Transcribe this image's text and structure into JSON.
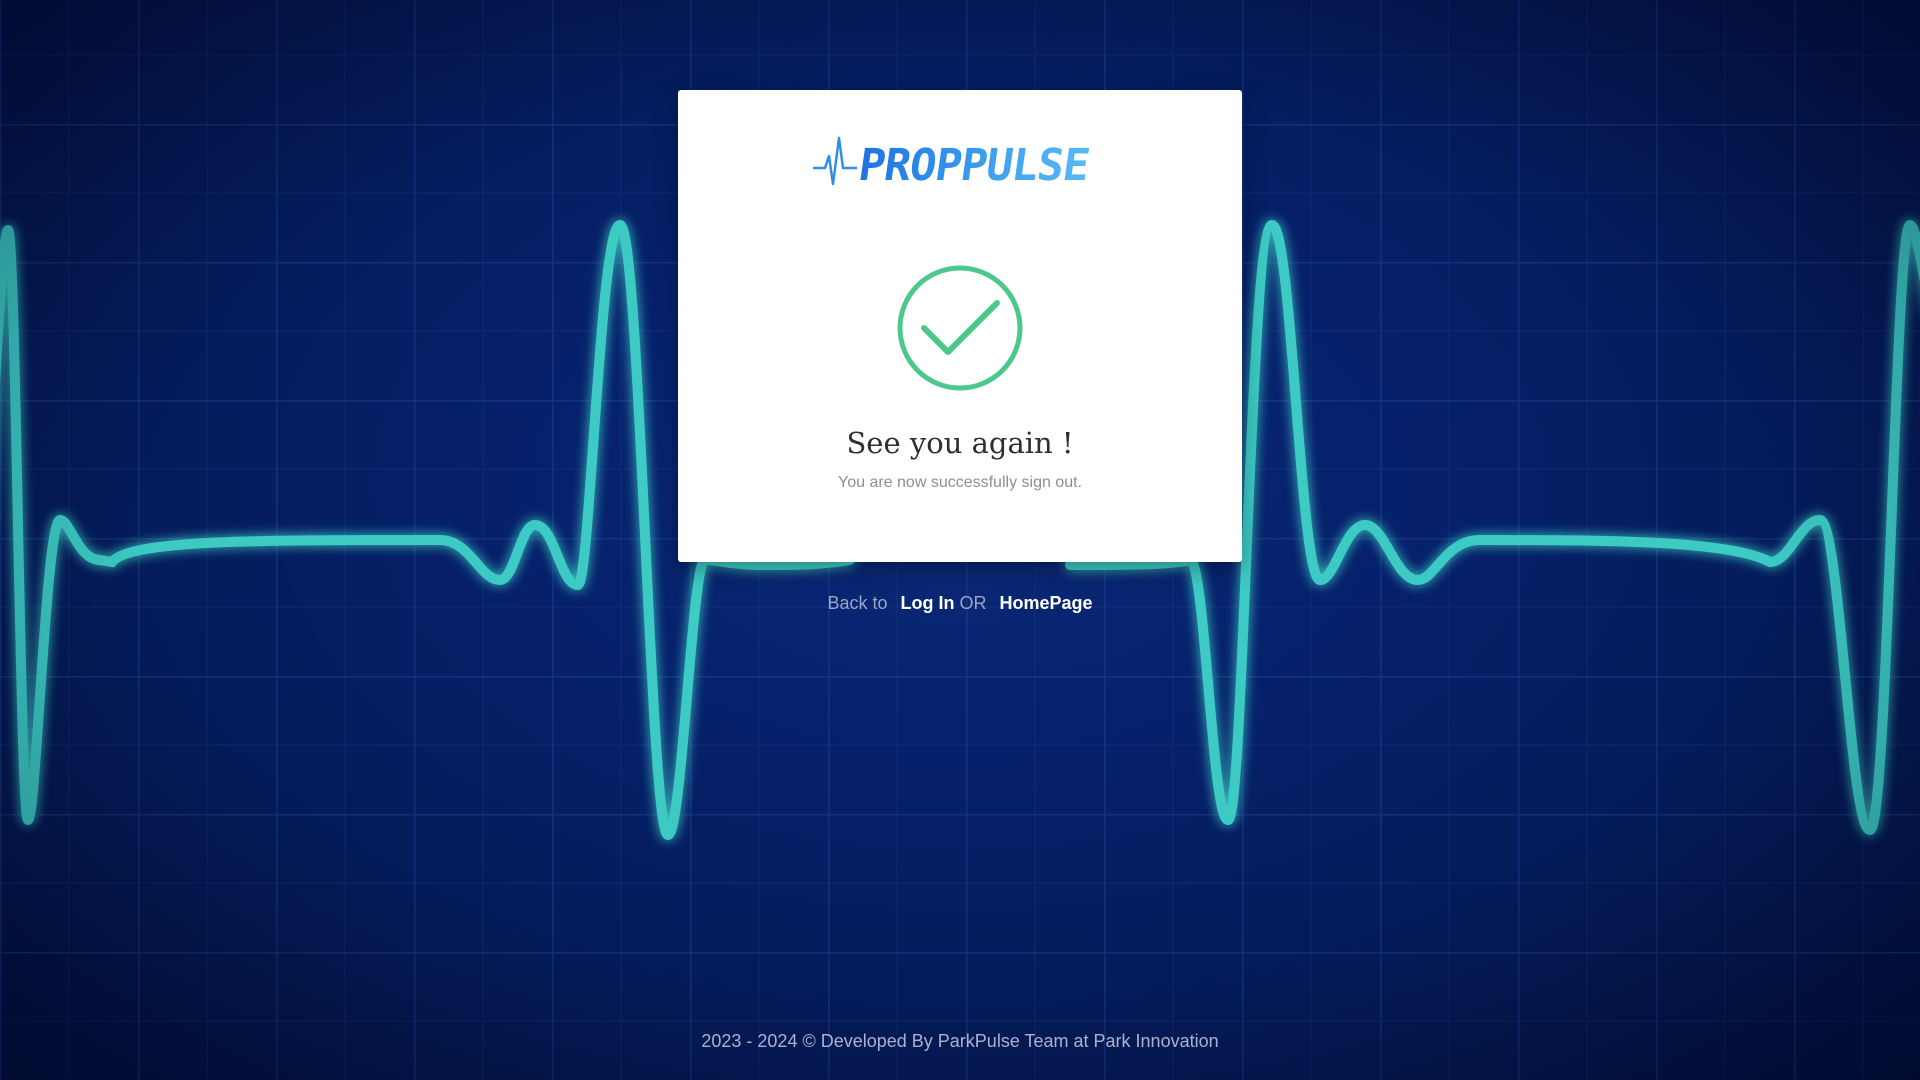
{
  "brand": {
    "logo_text": "PROPPULSE",
    "colors": {
      "logo_start": "#1f73e0",
      "logo_end": "#5ab8f6"
    }
  },
  "status": {
    "icon": "check-circle-icon",
    "icon_color": "#4cc98a",
    "title": "See you again !",
    "message": "You are now successfully sign out."
  },
  "navigation": {
    "prefix": "Back to",
    "login_label": "Log In",
    "separator": "OR",
    "homepage_label": "HomePage"
  },
  "footer": {
    "text": "2023 - 2024 © Developed By ParkPulse Team at Park Innovation"
  },
  "background": {
    "description_icon": "heartbeat-ecg-icon",
    "line_color": "#3fd4c9"
  }
}
